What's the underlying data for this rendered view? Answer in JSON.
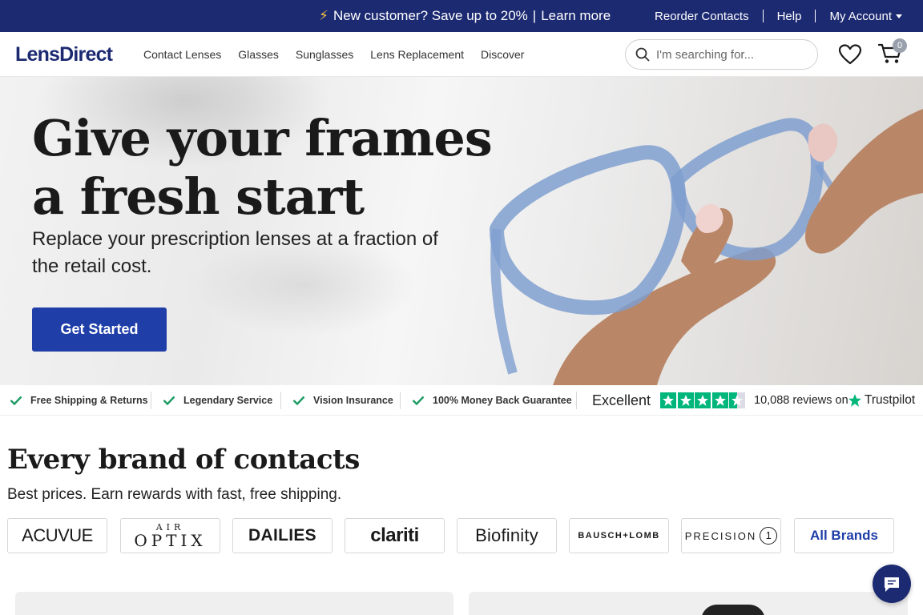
{
  "promo": {
    "icon": "lightning-bolt-icon",
    "message": "New customer? Save up to 20%",
    "separator": "|",
    "link": "Learn more",
    "links": {
      "reorder": "Reorder Contacts",
      "help": "Help",
      "account": "My Account"
    },
    "background_color": "#1c2a72"
  },
  "header": {
    "logo": "LensDirect",
    "nav": [
      "Contact Lenses",
      "Glasses",
      "Sunglasses",
      "Lens Replacement",
      "Discover"
    ],
    "search_placeholder": "I'm searching for...",
    "cart_count": "0"
  },
  "hero": {
    "title_line1": "Give your frames",
    "title_line2": "a fresh start",
    "subtitle": "Replace your prescription lenses at a fraction of the retail cost.",
    "cta": "Get Started",
    "cta_color": "#1f3ea8"
  },
  "benefits": [
    "Free Shipping & Returns",
    "Legendary Service",
    "Vision Insurance",
    "100% Money Back Guarantee"
  ],
  "trustpilot": {
    "rating_text": "Excellent",
    "stars": 4.5,
    "reviews": "10,088 reviews on",
    "brand": "Trustpilot",
    "star_color": "#00b67a"
  },
  "brands": {
    "title": "Every brand of contacts",
    "subtitle": "Best prices. Earn rewards with fast, free shipping.",
    "acuvue": "ACUVUE",
    "airoptix_top": "AIR",
    "airoptix_bottom": "OPTIX",
    "dailies": "DAILIES",
    "clariti": "clariti",
    "biofinity": "Biofinity",
    "bausch": "BAUSCH+LOMB",
    "precision": "PRECISION",
    "precision_num": "1",
    "all": "All Brands"
  }
}
